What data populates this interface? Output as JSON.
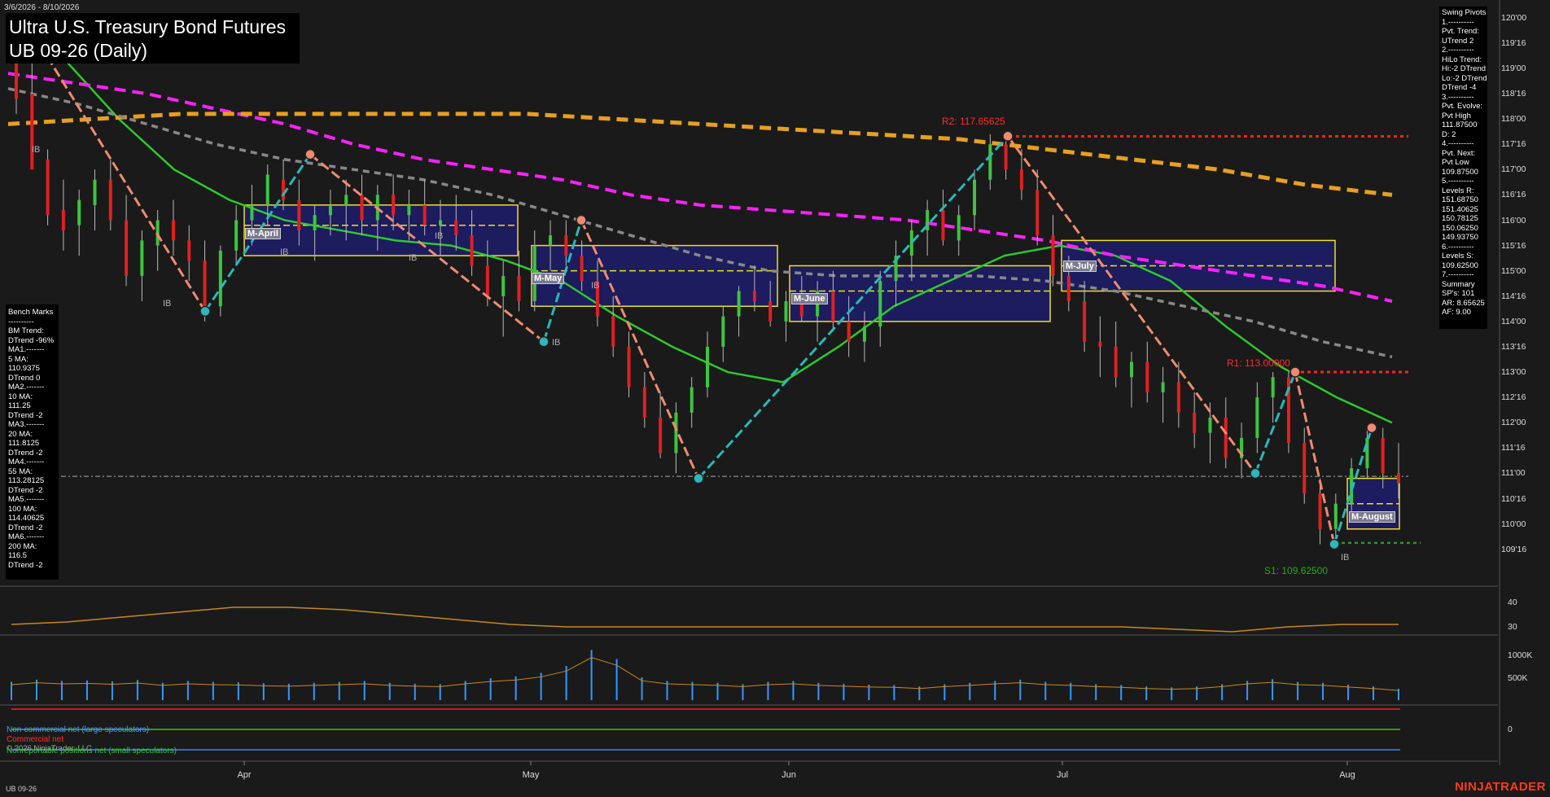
{
  "header": {
    "date_range": "3/6/2026 - 8/10/2026",
    "title_line1": "Ultra U.S. Treasury Bond Futures",
    "title_line2": "UB 09-26 (Daily)"
  },
  "bench_marks": [
    "Bench Marks",
    "----------",
    "BM Trend:",
    "DTrend -96%",
    "MA1.-------",
    "5 MA:",
    "110.9375",
    "DTrend 0",
    "MA2.-------",
    "10 MA:",
    "111.25",
    "DTrend -2",
    "MA3.-------",
    "20 MA:",
    "111.8125",
    "DTrend -2",
    "MA4.-------",
    "55 MA:",
    "113.28125",
    "DTrend -2",
    "MA5.-------",
    "100 MA:",
    "114.40625",
    "DTrend -2",
    "MA6.-------",
    "200 MA:",
    "116.5",
    "DTrend -2"
  ],
  "swing_pivots": [
    "Swing Pivots",
    "1.----------",
    "Pvt. Trend:",
    "UTrend 2",
    "2.----------",
    "HiLo Trend:",
    "Hi:-2 DTrend",
    "Lo:-2 DTrend",
    "DTrend -4",
    "3.----------",
    "Pvt. Evolve:",
    "Pvt High",
    "111.87500",
    "D: 2",
    "4.----------",
    "Pvt. Next:",
    "Pvt Low",
    "109.87500",
    "5.----------",
    "Levels R:",
    "151.68750",
    "151.40625",
    "150.78125",
    "150.06250",
    "149.93750",
    "6.----------",
    "Levels S:",
    "109.62500",
    "7.----------",
    "Summary",
    "SP's: 101",
    "AR: 8.65625",
    "AF: 9.00"
  ],
  "levels": {
    "r2_label": "R2: 117.65625",
    "r1_label": "R1: 113.00000",
    "s1_label": "S1: 109.62500"
  },
  "month_tags": [
    "M-April",
    "M-May",
    "M-June",
    "M-July",
    "M-August"
  ],
  "ib_labels": [
    "IB",
    "IB",
    "IB",
    "IB",
    "IB",
    "IB",
    "IB",
    "IB"
  ],
  "legend": {
    "noncommercial": "Non-commercial net (large speculators)",
    "commercial": "Commercial net",
    "nonreportable": "Nonreportable positions net (small speculators)",
    "copyright": "© 2026 NinjaTrader, LLC"
  },
  "footer": {
    "instrument": "UB 09-26",
    "brand": "NINJATRADER"
  },
  "colors": {
    "up_candle": "#3ec43e",
    "down_candle": "#e02020",
    "ma_green": "#2ec82e",
    "ma_magenta": "#ff22ff",
    "ma_orange": "#e6a020",
    "ma_gray": "#888888",
    "pivot_up": "#2ab8b8",
    "pivot_down": "#f08a70",
    "volume": "#3399ff",
    "brand": "#ff3b1a"
  },
  "chart_data": {
    "type": "candlestick",
    "y_axis": {
      "range": [
        109.125,
        120.125
      ],
      "ticks": [
        "120'00",
        "119'16",
        "119'00",
        "118'16",
        "118'00",
        "117'16",
        "117'00",
        "116'16",
        "116'00",
        "115'16",
        "115'00",
        "114'16",
        "114'00",
        "113'16",
        "113'00",
        "112'16",
        "112'00",
        "111'16",
        "111'00",
        "110'16",
        "110'00",
        "109'16"
      ]
    },
    "x_axis": {
      "ticks": [
        "Apr",
        "May",
        "Jun",
        "Jul",
        "Aug"
      ]
    },
    "ohlc": [
      [
        119.2,
        119.6,
        118.1,
        118.4
      ],
      [
        118.5,
        119.5,
        117.6,
        117.0
      ],
      [
        117.2,
        117.4,
        115.9,
        116.1
      ],
      [
        116.2,
        116.8,
        115.4,
        115.8
      ],
      [
        115.9,
        116.6,
        115.3,
        116.4
      ],
      [
        116.3,
        117.0,
        115.8,
        116.8
      ],
      [
        116.8,
        117.2,
        115.8,
        116.0
      ],
      [
        116.0,
        116.5,
        114.7,
        114.9
      ],
      [
        114.9,
        115.8,
        114.4,
        115.6
      ],
      [
        115.5,
        116.2,
        115.0,
        116.0
      ],
      [
        116.0,
        116.4,
        115.3,
        115.6
      ],
      [
        115.6,
        115.9,
        114.8,
        115.2
      ],
      [
        115.2,
        115.6,
        114.0,
        114.3
      ],
      [
        114.3,
        115.5,
        114.1,
        115.4
      ],
      [
        115.4,
        116.3,
        115.1,
        116.0
      ],
      [
        116.0,
        116.7,
        115.5,
        116.3
      ],
      [
        116.3,
        117.1,
        115.9,
        116.9
      ],
      [
        116.8,
        117.2,
        116.2,
        116.4
      ],
      [
        116.4,
        116.8,
        115.5,
        115.8
      ],
      [
        115.8,
        116.3,
        115.2,
        116.1
      ],
      [
        116.1,
        116.6,
        115.7,
        116.3
      ],
      [
        116.3,
        116.8,
        115.6,
        116.5
      ],
      [
        116.5,
        116.9,
        115.7,
        116.0
      ],
      [
        116.0,
        116.7,
        115.4,
        116.5
      ],
      [
        116.5,
        116.9,
        115.8,
        116.1
      ],
      [
        116.1,
        116.6,
        115.6,
        116.3
      ],
      [
        116.3,
        116.8,
        115.7,
        115.9
      ],
      [
        115.9,
        116.4,
        115.3,
        116.0
      ],
      [
        116.0,
        116.5,
        115.4,
        115.7
      ],
      [
        115.7,
        116.2,
        114.9,
        115.1
      ],
      [
        115.1,
        115.6,
        114.3,
        114.5
      ],
      [
        114.5,
        115.2,
        113.7,
        114.9
      ],
      [
        114.9,
        115.4,
        114.2,
        114.4
      ],
      [
        114.4,
        115.8,
        114.2,
        115.5
      ],
      [
        115.5,
        116.0,
        115.0,
        115.7
      ],
      [
        115.7,
        116.0,
        115.1,
        115.3
      ],
      [
        115.3,
        115.6,
        114.6,
        114.8
      ],
      [
        114.8,
        115.2,
        113.9,
        114.1
      ],
      [
        114.1,
        114.5,
        113.3,
        113.5
      ],
      [
        113.5,
        113.8,
        112.5,
        112.7
      ],
      [
        112.7,
        113.0,
        111.9,
        112.1
      ],
      [
        112.1,
        112.6,
        111.3,
        111.4
      ],
      [
        111.4,
        112.4,
        111.0,
        112.2
      ],
      [
        112.2,
        112.9,
        111.9,
        112.7
      ],
      [
        112.7,
        113.8,
        112.5,
        113.5
      ],
      [
        113.5,
        114.3,
        113.2,
        114.1
      ],
      [
        114.1,
        114.7,
        113.7,
        114.6
      ],
      [
        114.6,
        115.1,
        114.2,
        114.4
      ],
      [
        114.4,
        114.8,
        113.9,
        114.0
      ],
      [
        114.0,
        114.6,
        113.6,
        114.4
      ],
      [
        114.4,
        114.9,
        114.0,
        114.1
      ],
      [
        114.1,
        114.8,
        113.6,
        114.6
      ],
      [
        114.6,
        115.0,
        113.8,
        114.0
      ],
      [
        114.0,
        114.5,
        113.3,
        113.6
      ],
      [
        113.6,
        114.2,
        113.2,
        113.9
      ],
      [
        113.9,
        115.0,
        113.5,
        114.8
      ],
      [
        114.8,
        115.6,
        114.3,
        115.3
      ],
      [
        115.3,
        116.0,
        114.8,
        115.8
      ],
      [
        115.8,
        116.4,
        115.3,
        116.2
      ],
      [
        116.2,
        116.6,
        115.5,
        115.6
      ],
      [
        115.6,
        116.3,
        115.3,
        116.1
      ],
      [
        116.1,
        117.0,
        115.8,
        116.8
      ],
      [
        116.8,
        117.7,
        116.6,
        117.5
      ],
      [
        117.5,
        117.6,
        116.8,
        117.0
      ],
      [
        117.0,
        117.4,
        116.4,
        116.6
      ],
      [
        116.6,
        117.0,
        115.5,
        115.7
      ],
      [
        115.7,
        116.1,
        114.7,
        114.9
      ],
      [
        114.9,
        115.3,
        114.2,
        114.4
      ],
      [
        114.4,
        114.8,
        113.4,
        113.6
      ],
      [
        113.6,
        114.1,
        112.9,
        113.5
      ],
      [
        113.5,
        114.0,
        112.7,
        112.9
      ],
      [
        112.9,
        113.4,
        112.3,
        113.2
      ],
      [
        113.2,
        113.6,
        112.4,
        112.6
      ],
      [
        112.6,
        113.1,
        112.0,
        112.8
      ],
      [
        112.8,
        113.2,
        111.9,
        112.2
      ],
      [
        112.2,
        112.6,
        111.5,
        111.8
      ],
      [
        111.8,
        112.4,
        111.2,
        112.1
      ],
      [
        112.1,
        112.5,
        111.1,
        111.3
      ],
      [
        111.3,
        112.0,
        110.9,
        111.7
      ],
      [
        111.7,
        112.8,
        111.4,
        112.5
      ],
      [
        112.5,
        113.0,
        112.0,
        112.9
      ],
      [
        112.9,
        113.0,
        111.4,
        111.6
      ],
      [
        111.6,
        111.9,
        110.4,
        110.6
      ],
      [
        110.6,
        110.9,
        109.6,
        109.9
      ],
      [
        109.9,
        110.6,
        109.7,
        110.4
      ],
      [
        110.4,
        111.3,
        110.2,
        111.1
      ],
      [
        111.1,
        111.9,
        110.9,
        111.7
      ],
      [
        111.7,
        111.9,
        110.7,
        111.0
      ],
      [
        111.0,
        111.6,
        110.5,
        110.8
      ]
    ],
    "pivots": [
      {
        "label": "high",
        "value": 119.7
      },
      {
        "label": "low",
        "value": 114.2
      },
      {
        "label": "high",
        "value": 117.3
      },
      {
        "label": "low",
        "value": 113.6
      },
      {
        "label": "high",
        "value": 116.0
      },
      {
        "label": "low",
        "value": 110.9
      },
      {
        "label": "high",
        "value": 117.66
      },
      {
        "label": "low",
        "value": 111.0
      },
      {
        "label": "high",
        "value": 113.0
      },
      {
        "label": "low",
        "value": 109.6
      },
      {
        "label": "high",
        "value": 111.9
      }
    ],
    "levels": {
      "R2": 117.65625,
      "R1": 113.0,
      "S1": 109.625,
      "current": 110.94
    },
    "moving_averages": [
      {
        "color": "#2ec82e",
        "values": [
          119.8,
          119.2,
          118.0,
          117.0,
          116.4,
          116.0,
          115.8,
          115.6,
          115.5,
          115.2,
          114.8,
          114.1,
          113.5,
          113.0,
          112.8,
          113.5,
          114.3,
          114.8,
          115.3,
          115.5,
          115.3,
          114.8,
          113.9,
          113.1,
          112.5,
          112.0
        ]
      },
      {
        "color": "#ff22ff",
        "values": [
          118.9,
          118.7,
          118.5,
          118.2,
          117.9,
          117.5,
          117.2,
          117.0,
          116.8,
          116.5,
          116.3,
          116.2,
          116.1,
          116.0,
          115.8,
          115.6,
          115.3,
          115.1,
          114.9,
          114.7,
          114.4
        ]
      },
      {
        "color": "#e6a020",
        "values": [
          117.9,
          118.0,
          118.1,
          118.1,
          118.1,
          118.1,
          118.1,
          118.0,
          117.9,
          117.8,
          117.7,
          117.6,
          117.4,
          117.2,
          117.0,
          116.7,
          116.5
        ]
      },
      {
        "color": "#888888",
        "values": [
          118.6,
          118.3,
          117.9,
          117.5,
          117.2,
          117.0,
          116.8,
          116.5,
          116.1,
          115.7,
          115.3,
          115.0,
          114.9,
          114.9,
          114.9,
          114.8,
          114.6,
          114.3,
          114.0,
          113.6,
          113.3
        ]
      }
    ],
    "value_areas": [
      {
        "tag": "M-April",
        "hi": 116.3,
        "mid": 115.9,
        "lo": 115.3
      },
      {
        "tag": "M-May",
        "hi": 115.5,
        "mid": 115.0,
        "lo": 114.3
      },
      {
        "tag": "M-June",
        "hi": 115.1,
        "mid": 114.6,
        "lo": 114.0
      },
      {
        "tag": "M-July",
        "hi": 115.6,
        "mid": 115.1,
        "lo": 114.6
      },
      {
        "tag": "M-August",
        "hi": 110.9,
        "mid": 110.4,
        "lo": 109.9
      }
    ],
    "adx_panel": {
      "ticks": [
        "40",
        "30"
      ],
      "values": [
        31,
        32,
        34,
        36,
        38,
        38,
        37,
        35,
        33,
        31,
        30,
        30,
        30,
        30,
        30,
        30,
        30,
        30,
        30,
        30,
        30,
        29,
        28,
        30,
        31,
        31
      ]
    },
    "volume_panel": {
      "ticks": [
        "1000K",
        "500K"
      ],
      "values": [
        400,
        450,
        420,
        430,
        410,
        440,
        380,
        420,
        400,
        390,
        370,
        360,
        380,
        400,
        420,
        380,
        360,
        350,
        420,
        480,
        520,
        600,
        750,
        1100,
        900,
        500,
        420,
        400,
        380,
        350,
        400,
        420,
        380,
        360,
        340,
        330,
        300,
        350,
        380,
        420,
        450,
        400,
        380,
        350,
        330,
        300,
        280,
        300,
        350,
        420,
        460,
        400,
        380,
        340,
        300,
        250
      ]
    },
    "cot_panel": {
      "ticks": [
        "0"
      ]
    }
  }
}
